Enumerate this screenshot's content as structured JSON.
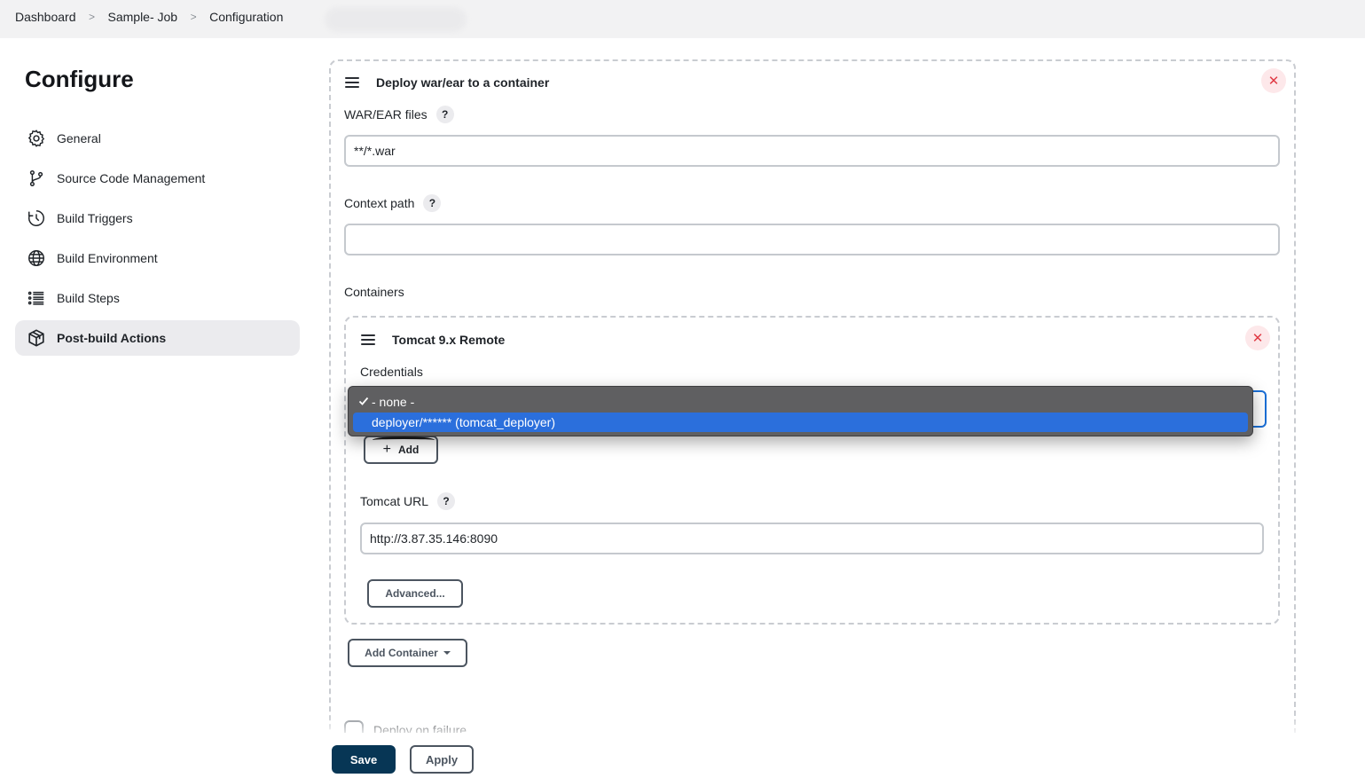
{
  "breadcrumb": {
    "items": [
      "Dashboard",
      "Sample- Job",
      "Configuration"
    ],
    "separator": ">"
  },
  "page_title": "Configure",
  "sidebar": {
    "items": [
      {
        "label": "General",
        "icon": "gear-icon"
      },
      {
        "label": "Source Code Management",
        "icon": "git-branch-icon"
      },
      {
        "label": "Build Triggers",
        "icon": "clock-icon"
      },
      {
        "label": "Build Environment",
        "icon": "globe-icon"
      },
      {
        "label": "Build Steps",
        "icon": "list-icon"
      },
      {
        "label": "Post-build Actions",
        "icon": "package-icon",
        "active": true
      }
    ]
  },
  "deploy_section": {
    "title": "Deploy war/ear to a container",
    "war_label": "WAR/EAR files",
    "war_value": "**/*.war",
    "context_label": "Context path",
    "context_value": "",
    "containers_label": "Containers",
    "help_glyph": "?",
    "close_glyph": "✕"
  },
  "container": {
    "title": "Tomcat 9.x Remote",
    "credentials_label": "Credentials",
    "add_button": "Add",
    "add_glyph": "+",
    "tomcat_url_label": "Tomcat URL",
    "tomcat_url_value": "http://3.87.35.146:8090",
    "advanced_button": "Advanced..."
  },
  "credentials_dropdown": {
    "options": [
      {
        "label": "- none -",
        "checked": true
      },
      {
        "label": "deployer/****** (tomcat_deployer)",
        "highlighted": true
      }
    ]
  },
  "add_container_button": "Add Container",
  "deploy_on_failure_label": "Deploy on failure",
  "footer": {
    "save": "Save",
    "apply": "Apply"
  },
  "colors": {
    "save_bg": "#073655",
    "highlight": "#2b6fdc",
    "danger": "#e03b45"
  }
}
